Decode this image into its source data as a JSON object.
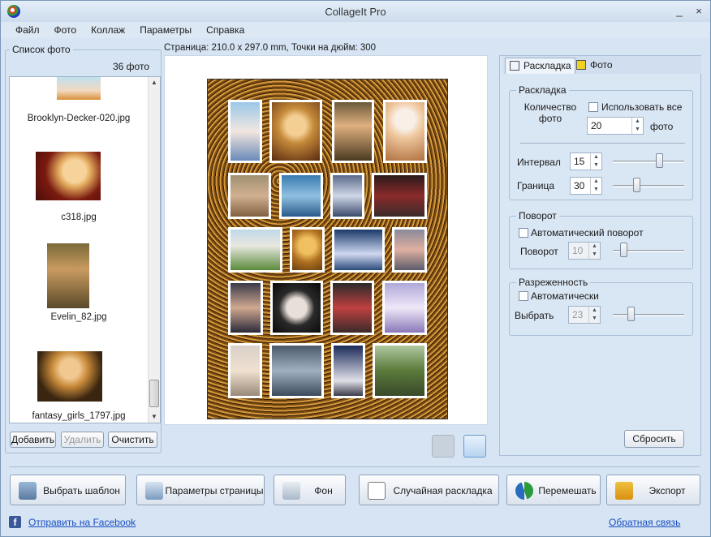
{
  "window": {
    "title": "CollageIt Pro",
    "minimize": "_",
    "close": "×"
  },
  "menu": [
    "Файл",
    "Фото",
    "Коллаж",
    "Параметры",
    "Справка"
  ],
  "photo_panel": {
    "title": "Список фото",
    "count": "36 фото",
    "files": [
      "Brooklyn-Decker-020.jpg",
      "c318.jpg",
      "Evelin_82.jpg",
      "fantasy_girls_1797.jpg"
    ],
    "buttons": {
      "add": "Добавить",
      "remove": "Удалить",
      "clear": "Очистить"
    }
  },
  "page_info": "Страница: 210.0 x 297.0 mm, Точки на дюйм: 300",
  "tabs": {
    "layout": "Раскладка",
    "photo": "Фото"
  },
  "layout_group": {
    "title": "Раскладка",
    "count_label": "Количество фото",
    "use_all": "Использовать все",
    "count_value": "20",
    "count_unit": "фото",
    "interval_label": "Интервал",
    "interval_value": "15",
    "border_label": "Граница",
    "border_value": "30"
  },
  "rotation_group": {
    "title": "Поворот",
    "auto": "Автоматический поворот",
    "label": "Поворот",
    "value": "10"
  },
  "sparse_group": {
    "title": "Разреженность",
    "auto": "Автоматически",
    "label": "Выбрать",
    "value": "23"
  },
  "reset_button": "Сбросить",
  "bottom_buttons": {
    "template": "Выбрать шаблон",
    "page_params": "Параметры страницы",
    "background": "Фон",
    "random": "Случайная раскладка",
    "shuffle": "Перемешать",
    "export": "Экспорт"
  },
  "links": {
    "facebook": "Отправить на Facebook",
    "feedback": "Обратная связь"
  },
  "colors": {
    "accent": "#1a4fc4",
    "window_bg": "#d6e4f3",
    "facebook": "#3b5998"
  }
}
